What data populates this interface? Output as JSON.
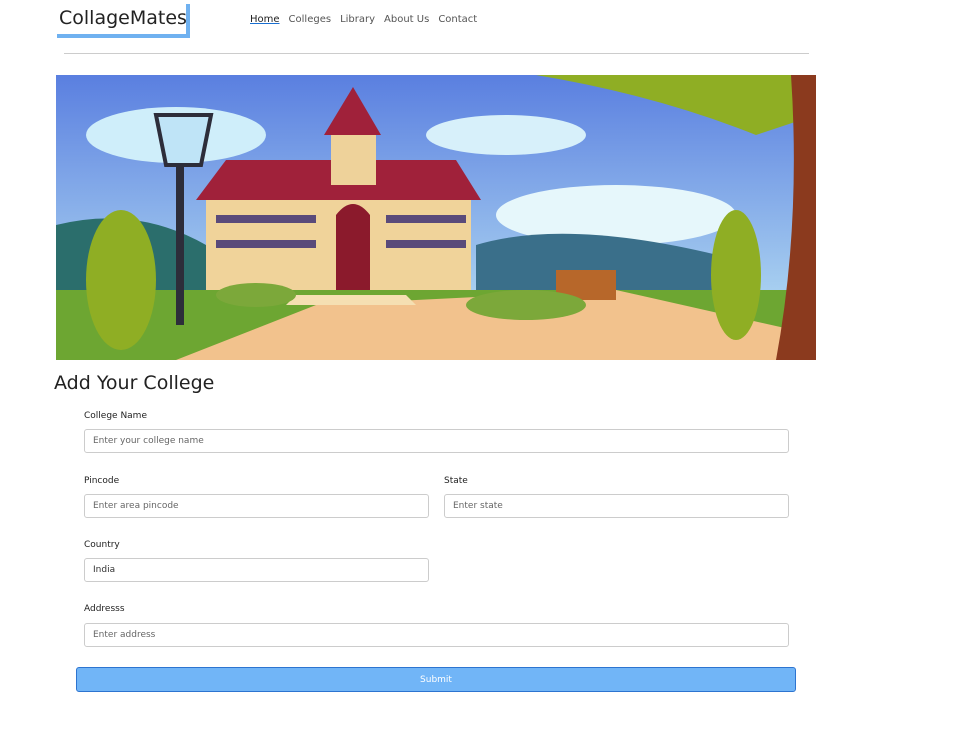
{
  "brand": "CollageMates",
  "nav": [
    {
      "label": "Home",
      "active": true
    },
    {
      "label": "Colleges"
    },
    {
      "label": "Library"
    },
    {
      "label": "About Us"
    },
    {
      "label": "Contact"
    }
  ],
  "form": {
    "title": "Add Your College",
    "college_name": {
      "label": "College Name",
      "placeholder": "Enter your college name"
    },
    "pincode": {
      "label": "Pincode",
      "placeholder": "Enter area pincode"
    },
    "state": {
      "label": "State",
      "placeholder": "Enter state"
    },
    "country": {
      "label": "Country",
      "value": "India"
    },
    "address": {
      "label": "Addresss",
      "placeholder": "Enter address"
    },
    "submit_label": "Submit"
  },
  "colors": {
    "accent": "#71b5f7",
    "logo_border": "#6fb1f0"
  }
}
